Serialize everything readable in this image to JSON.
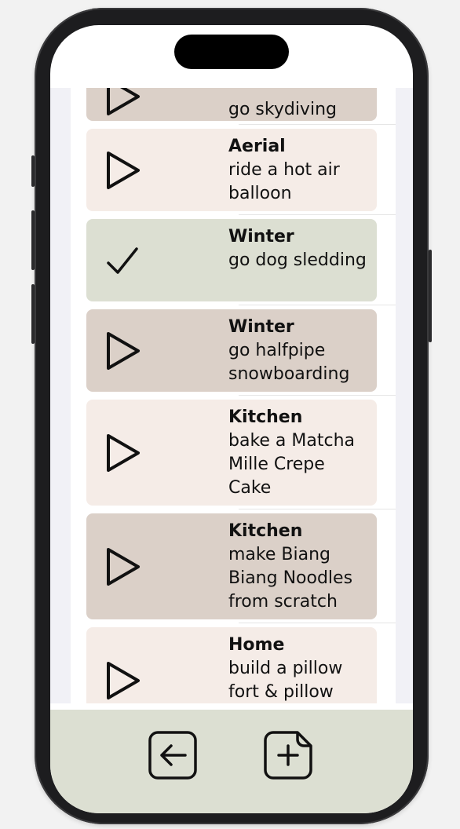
{
  "items": [
    {
      "title": "",
      "desc": "go skydiving",
      "status": "play",
      "color": "taupe"
    },
    {
      "title": "Aerial",
      "desc": "ride a hot air balloon",
      "status": "play",
      "color": "light"
    },
    {
      "title": "Winter",
      "desc": "go dog sledding",
      "status": "done",
      "color": "green"
    },
    {
      "title": "Winter",
      "desc": "go halfpipe snowboarding",
      "status": "play",
      "color": "taupe"
    },
    {
      "title": "Kitchen",
      "desc": "bake a Matcha Mille Crepe Cake",
      "status": "play",
      "color": "light"
    },
    {
      "title": "Kitchen",
      "desc": "make Biang Biang Noodles from scratch",
      "status": "play",
      "color": "taupe"
    },
    {
      "title": "Home",
      "desc": "build a pillow fort & pillow",
      "status": "play",
      "color": "light"
    }
  ],
  "toolbar": {
    "back_icon": "arrow-left-square-icon",
    "add_icon": "document-plus-icon"
  },
  "colors": {
    "card_light": "#f5ece7",
    "card_taupe": "#dbd0c8",
    "card_done": "#dcdfd2",
    "toolbar_bg": "#dcdfd2"
  }
}
